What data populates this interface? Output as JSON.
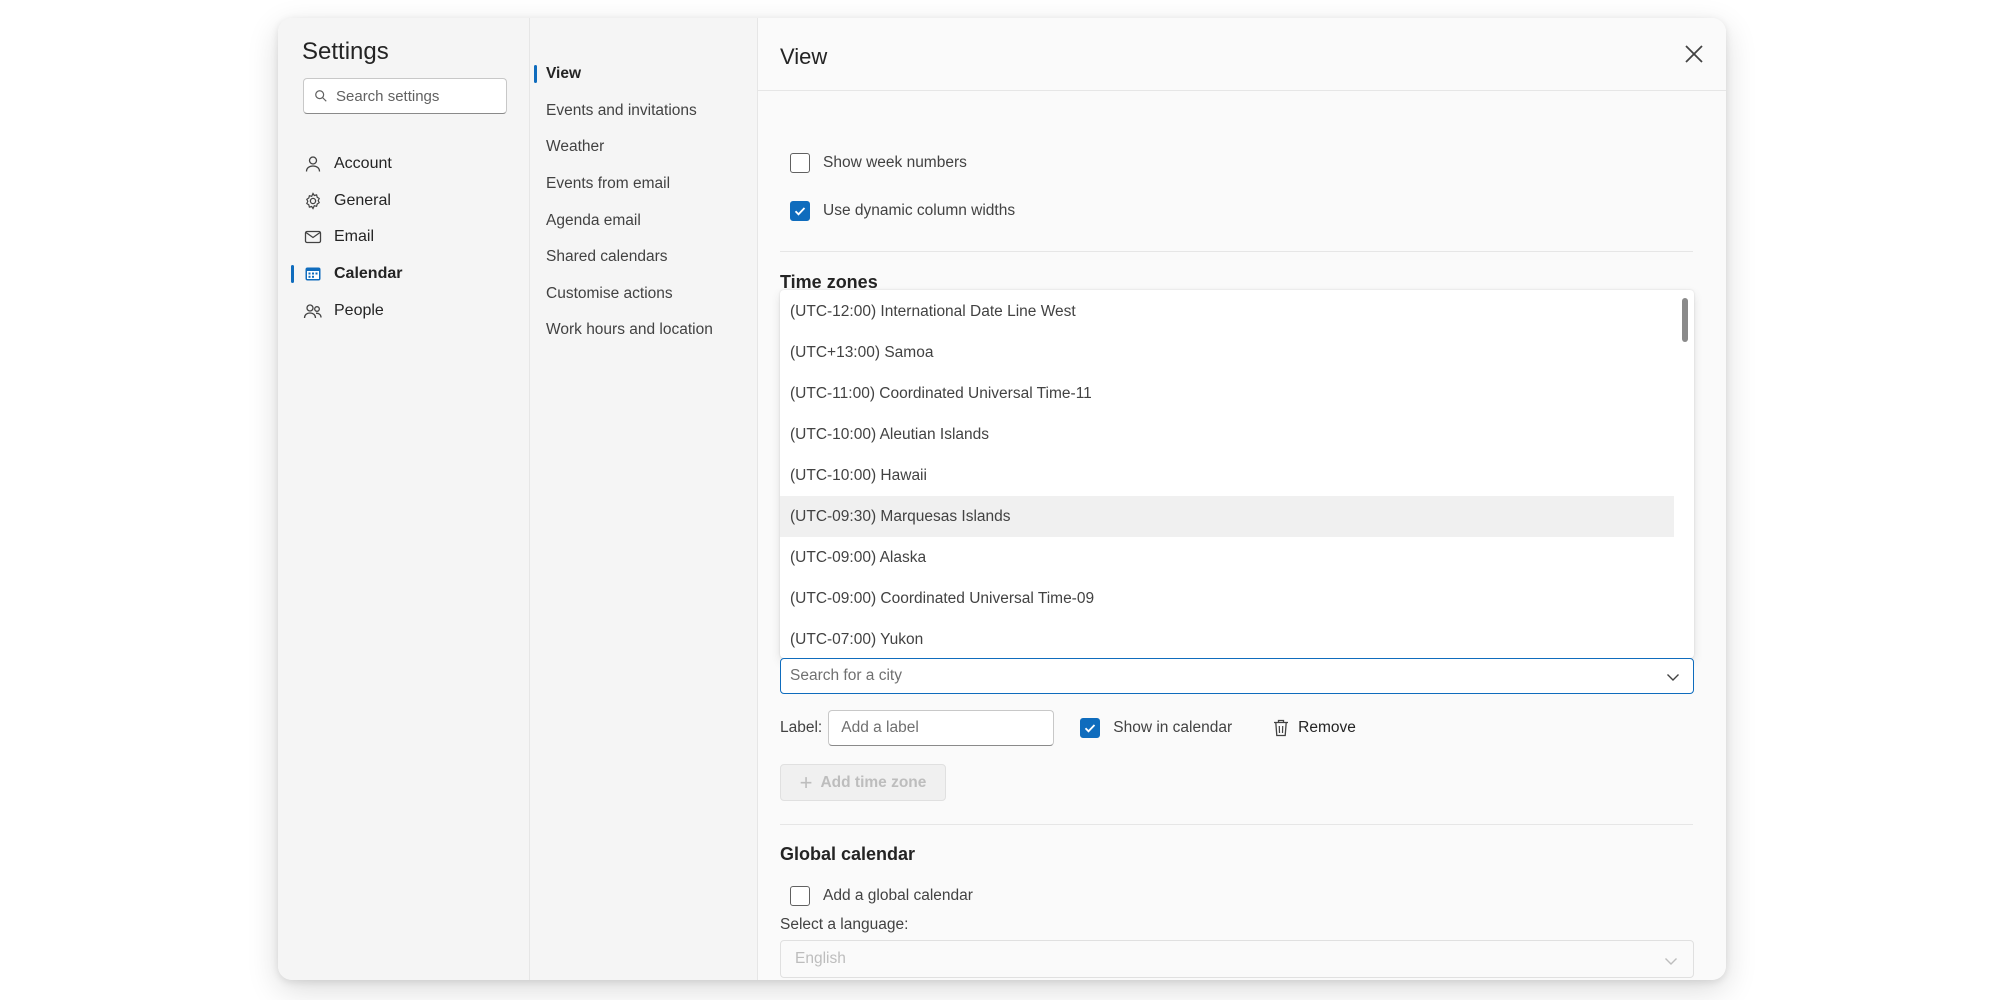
{
  "sidebar": {
    "title": "Settings",
    "search_placeholder": "Search settings",
    "categories": [
      {
        "label": "Account",
        "icon": "person-icon"
      },
      {
        "label": "General",
        "icon": "gear-icon"
      },
      {
        "label": "Email",
        "icon": "mail-icon"
      },
      {
        "label": "Calendar",
        "icon": "calendar-icon",
        "active": true
      },
      {
        "label": "People",
        "icon": "people-icon"
      }
    ]
  },
  "subnav": {
    "items": [
      {
        "label": "View",
        "active": true
      },
      {
        "label": "Events and invitations"
      },
      {
        "label": "Weather"
      },
      {
        "label": "Events from email"
      },
      {
        "label": "Agenda email"
      },
      {
        "label": "Shared calendars"
      },
      {
        "label": "Customise actions"
      },
      {
        "label": "Work hours and location"
      }
    ]
  },
  "panel": {
    "title": "View",
    "show_week_numbers": {
      "label": "Show week numbers",
      "checked": false
    },
    "dynamic_columns": {
      "label": "Use dynamic column widths",
      "checked": true
    },
    "time_zones": {
      "heading": "Time zones",
      "options": [
        "(UTC-12:00) International Date Line West",
        "(UTC+13:00) Samoa",
        "(UTC-11:00) Coordinated Universal Time-11",
        "(UTC-10:00) Aleutian Islands",
        "(UTC-10:00) Hawaii",
        "(UTC-09:30) Marquesas Islands",
        "(UTC-09:00) Alaska",
        "(UTC-09:00) Coordinated Universal Time-09",
        "(UTC-07:00) Yukon"
      ],
      "hovered_option": "(UTC-09:30) Marquesas Islands",
      "city_placeholder": "Search for a city",
      "label_text": "Label:",
      "label_placeholder": "Add a label",
      "show_in_calendar": {
        "label": "Show in calendar",
        "checked": true
      },
      "remove_label": "Remove",
      "add_button": "Add time zone"
    },
    "global_calendar": {
      "heading": "Global calendar",
      "add_label": "Add a global calendar",
      "checked": false,
      "language_label": "Select a language:",
      "language_value": "English"
    }
  },
  "colors": {
    "accent": "#0f6cbd",
    "text": "#242424",
    "muted": "#616161"
  }
}
